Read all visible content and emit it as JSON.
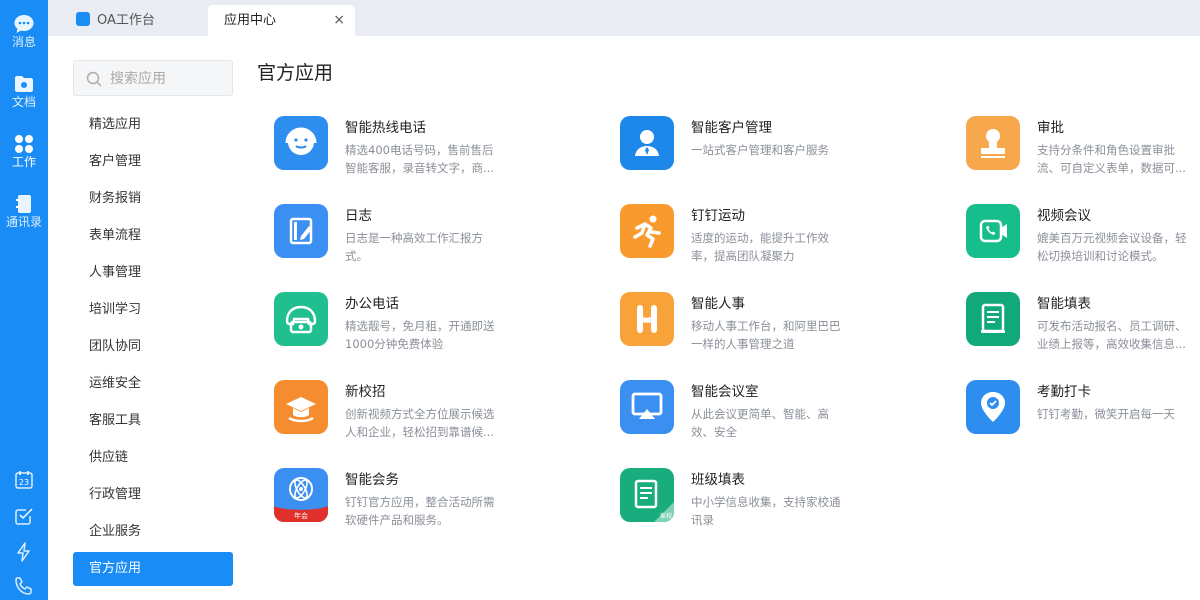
{
  "nav": {
    "items": [
      {
        "label": "消息",
        "icon": "chat-icon"
      },
      {
        "label": "文档",
        "icon": "folder-icon"
      },
      {
        "label": "工作",
        "icon": "apps-grid-icon"
      },
      {
        "label": "通讯录",
        "icon": "contacts-icon"
      }
    ],
    "bottom_icons": [
      "calendar-23-icon",
      "task-check-icon",
      "lightning-icon",
      "phone-call-icon"
    ],
    "calendar_day": "23",
    "accent": "#1a8cf5"
  },
  "tabs": [
    {
      "label": "OA工作台"
    },
    {
      "label": "应用中心",
      "close": "×"
    }
  ],
  "search": {
    "placeholder": "搜索应用"
  },
  "categories": [
    "精选应用",
    "客户管理",
    "财务报销",
    "表单流程",
    "人事管理",
    "培训学习",
    "团队协同",
    "运维安全",
    "客服工具",
    "供应链",
    "行政管理",
    "企业服务",
    "官方应用"
  ],
  "active_category": "官方应用",
  "section_title": "官方应用",
  "apps": [
    {
      "name": "智能热线电话",
      "desc": "精选400电话号码，售前售后智能客服，录音转文字，商...",
      "icon": "headset-icon",
      "color": "#2e8ef0"
    },
    {
      "name": "智能客户管理",
      "desc": "一站式客户管理和客户服务",
      "icon": "customer-icon",
      "color": "#1d87ea"
    },
    {
      "name": "审批",
      "desc": "支持分条件和角色设置审批流、可自定义表单，数据可...",
      "icon": "approval-stamp-icon",
      "color": "#f7a84c"
    },
    {
      "name": "日志",
      "desc": "日志是一种高效工作汇报方式。",
      "icon": "journal-icon",
      "color": "#3b8ef2"
    },
    {
      "name": "钉钉运动",
      "desc": "适度的运动，能提升工作效率，提高团队凝聚力",
      "icon": "running-icon",
      "color": "#f99a2e"
    },
    {
      "name": "视频会议",
      "desc": "媲美百万元视频会议设备，轻松切换培训和讨论模式。",
      "icon": "video-call-icon",
      "color": "#18bd8c"
    },
    {
      "name": "办公电话",
      "desc": "精选靓号，免月租，开通即送1000分钟免费体验",
      "icon": "office-phone-icon",
      "color": "#1fbf8f"
    },
    {
      "name": "智能人事",
      "desc": "移动人事工作台，和阿里巴巴一样的人事管理之道",
      "icon": "hr-h-icon",
      "color": "#f8a23a"
    },
    {
      "name": "智能填表",
      "desc": "可发布活动报名、员工调研、业绩上报等，高效收集信息...",
      "icon": "form-fill-icon",
      "color": "#11a97a"
    },
    {
      "name": "新校招",
      "desc": "创新视频方式全方位展示候选人和企业，轻松招到靠谱候...",
      "icon": "graduation-cap-icon",
      "color": "#f58c30"
    },
    {
      "name": "智能会议室",
      "desc": "从此会议更简单、智能、高效、安全",
      "icon": "airplay-icon",
      "color": "#3a8ff0"
    },
    {
      "name": "考勤打卡",
      "desc": "钉钉考勤，微笑开启每一天",
      "icon": "location-check-icon",
      "color": "#2e8ef0"
    },
    {
      "name": "智能会务",
      "desc": "钉钉官方应用，整合活动所需软硬件产品和服务。",
      "icon": "annual-meeting-icon",
      "color": "#3a8ff0",
      "badge": "年会"
    },
    {
      "name": "班级填表",
      "desc": "中小学信息收集，支持家校通讯录",
      "icon": "class-form-icon",
      "color": "#19ad7e",
      "badge": "家校"
    }
  ]
}
